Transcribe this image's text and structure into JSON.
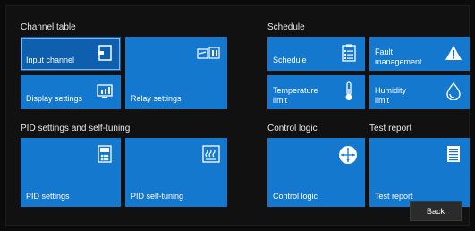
{
  "sections": {
    "channel": "Channel table",
    "pid": "PID settings and self-tuning",
    "schedule": "Schedule",
    "control": "Control logic",
    "report": "Test report"
  },
  "tiles": {
    "input_channel": "Input channel",
    "display_settings": "Display settings",
    "relay_settings": "Relay settings",
    "pid_settings": "PID settings",
    "pid_self_tuning": "PID self-tuning",
    "schedule": "Schedule",
    "fault_management": "Fault\nmanagement",
    "temperature_limit": "Temperature\nlimit",
    "humidity_limit": "Humidity\nlimit",
    "control_logic": "Control logic",
    "test_report": "Test report"
  },
  "back_label": "Back",
  "colors": {
    "tile": "#1578cf",
    "background": "#111111"
  }
}
